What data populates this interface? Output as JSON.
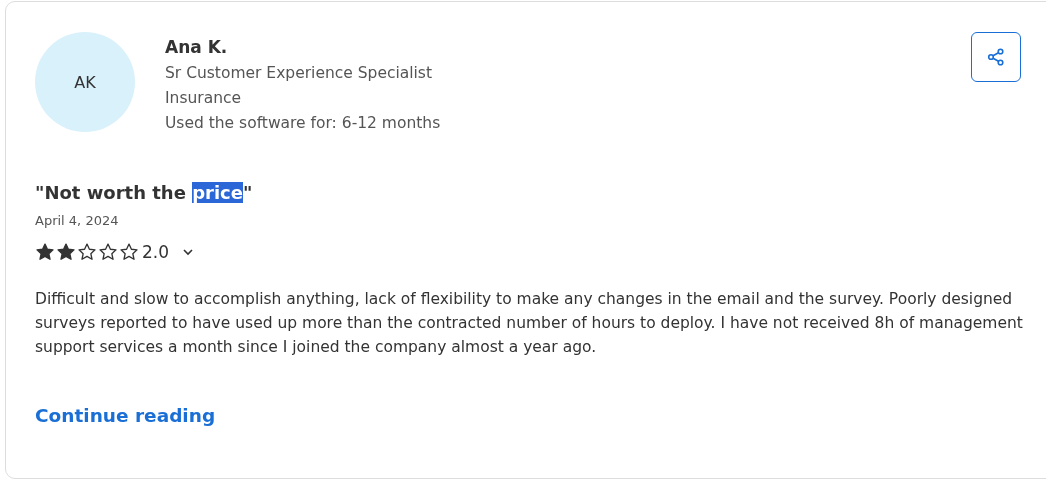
{
  "reviewer": {
    "initials": "AK",
    "name": "Ana K.",
    "job_title": "Sr Customer Experience Specialist",
    "industry": "Insurance",
    "usage": "Used the software for: 6-12 months"
  },
  "review": {
    "title_parts": [
      {
        "text": "\"Not worth the ",
        "highlighted": false
      },
      {
        "text": "price",
        "highlighted": true
      },
      {
        "text": "\"",
        "highlighted": false
      }
    ],
    "date": "April 4, 2024",
    "stars": 2,
    "rating": "2.0",
    "body": "Difficult and slow to accomplish anything, lack of flexibility to make any changes in the email and the survey. Poorly designed surveys reported to have used up more than the contracted number of hours to deploy. I have not received 8h of management support services a month since I joined the company almost a year ago.",
    "link": "Continue reading"
  }
}
